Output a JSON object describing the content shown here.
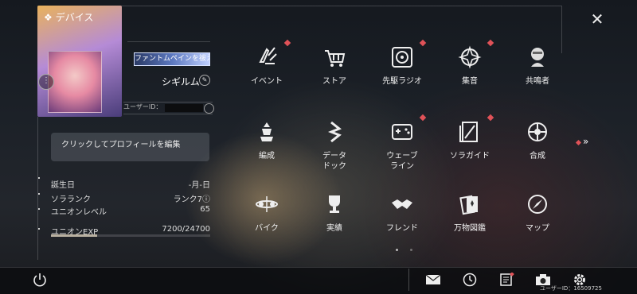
{
  "header": {
    "title": "デバイス"
  },
  "profile": {
    "badge": "ファントムペインを祓える",
    "name": "シギルム",
    "uid_label": "ユーザーID：",
    "edit_prompt": "クリックしてプロフィールを編集",
    "stats": [
      {
        "label": "誕生日",
        "value": "-月-日"
      },
      {
        "label": "ソラランク",
        "value": "ランク7"
      },
      {
        "label": "ユニオンレベル",
        "value": "65"
      }
    ],
    "exp": {
      "label": "ユニオンEXP",
      "value": "7200/24700",
      "fraction": 0.2915
    }
  },
  "menu": [
    {
      "label": "イベント",
      "icon": "event-icon",
      "alert": true
    },
    {
      "label": "ストア",
      "icon": "cart-icon",
      "alert": false
    },
    {
      "label": "先駆ラジオ",
      "icon": "radio-icon",
      "alert": true
    },
    {
      "label": "集音",
      "icon": "crosshair-icon",
      "alert": true
    },
    {
      "label": "共鳴者",
      "icon": "resonator-icon",
      "alert": false
    },
    {
      "label": "編成",
      "icon": "formation-icon",
      "alert": false
    },
    {
      "label": "データ\nドック",
      "icon": "data-dock-icon",
      "alert": false
    },
    {
      "label": "ウェーブ\nライン",
      "icon": "gamepad-icon",
      "alert": true
    },
    {
      "label": "ソラガイド",
      "icon": "guide-icon",
      "alert": true
    },
    {
      "label": "合成",
      "icon": "synthesis-icon",
      "alert": false
    },
    {
      "label": "バイク",
      "icon": "bike-icon",
      "alert": false
    },
    {
      "label": "実績",
      "icon": "trophy-icon",
      "alert": false
    },
    {
      "label": "フレンド",
      "icon": "handshake-icon",
      "alert": false
    },
    {
      "label": "万物図鑑",
      "icon": "cards-icon",
      "alert": false
    },
    {
      "label": "マップ",
      "icon": "compass-icon",
      "alert": false
    }
  ],
  "footer": {
    "uid": "ユーザーID：16509725"
  },
  "colors": {
    "alert": "#e05258",
    "accent": "#ffffff"
  }
}
